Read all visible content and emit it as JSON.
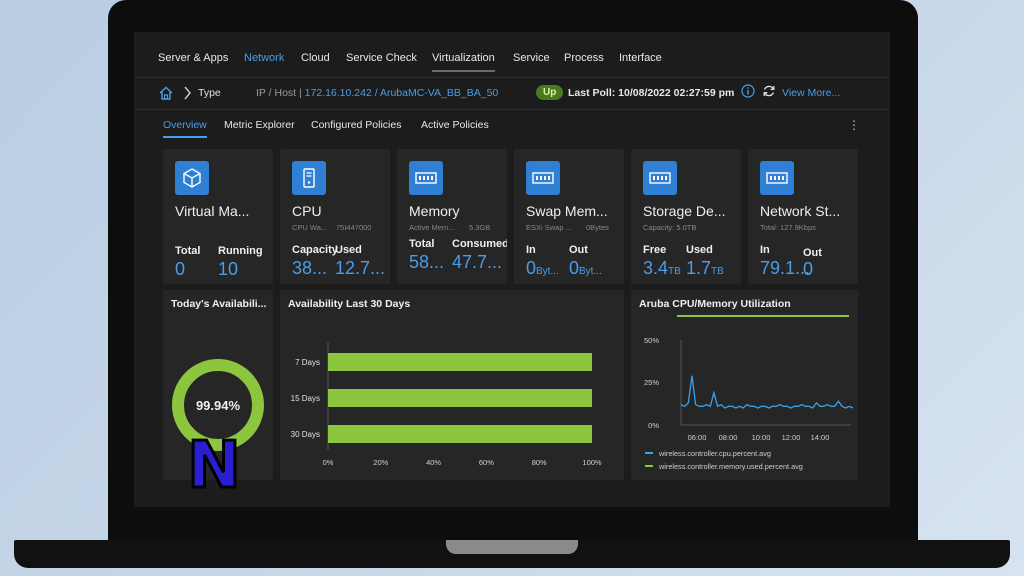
{
  "nav": {
    "tabs": [
      "Server & Apps",
      "Network",
      "Cloud",
      "Service Check",
      "Virtualization",
      "Service",
      "Process",
      "Interface"
    ],
    "active": "Network"
  },
  "breadcrumb": {
    "type_label": "Type",
    "path_prefix": "IP / Host | ",
    "path_link": "172.16.10.242 / ArubaMC-VA_BB_BA_50",
    "status": "Up",
    "last_poll": "Last Poll: 10/08/2022 02:27:59 pm",
    "view_more": "View More..."
  },
  "subtabs": [
    "Overview",
    "Metric Explorer",
    "Configured Policies",
    "Active Policies"
  ],
  "cards": {
    "virtual": {
      "title": "Virtual Ma...",
      "lbl1": "Total",
      "val1": "0",
      "lbl2": "Running",
      "val2": "10"
    },
    "cpu": {
      "title": "CPU",
      "sub": "CPU Wa...",
      "sub2": "75I447000",
      "lbl1": "Capacity",
      "val1": "38...",
      "lbl2": "Used",
      "val2": "12.7..."
    },
    "memory": {
      "title": "Memory",
      "sub": "Active Mem...",
      "sub2": "5.3GB",
      "lbl1": "Total",
      "val1": "58...",
      "lbl2": "Consumed",
      "val2": "47.7..."
    },
    "swap": {
      "title": "Swap Mem...",
      "sub": "ESXi Swap ...",
      "sub2": "0Bytes",
      "lbl1": "In",
      "val1": "0",
      "unit1": "Byt...",
      "lbl2": "Out",
      "val2": "0",
      "unit2": "Byt..."
    },
    "storage": {
      "title": "Storage De...",
      "sub": "Capacity: 5.0TB",
      "lbl1": "Free",
      "val1": "3.4",
      "unit1": "TB",
      "lbl2": "Used",
      "val2": "1.7",
      "unit2": "TB"
    },
    "network": {
      "title": "Network St...",
      "sub": "Total: 127.9Kbps",
      "lbl1": "In",
      "val1": "79.1...",
      "lbl2": "Out",
      "val2": "0"
    }
  },
  "availability_today": {
    "title": "Today's Availabili...",
    "value": "99.94%",
    "fraction": 0.9994
  },
  "availability_30": {
    "title": "Availability Last 30 Days",
    "chart_data": {
      "type": "bar",
      "orientation": "horizontal",
      "categories": [
        "7 Days",
        "15 Days",
        "30 Days"
      ],
      "values": [
        100,
        100,
        100
      ],
      "xlim": [
        0,
        100
      ],
      "xticks": [
        "0%",
        "20%",
        "40%",
        "60%",
        "80%",
        "100%"
      ],
      "color": "#8cc63f"
    }
  },
  "cpu_mem": {
    "title": "Aruba CPU/Memory Utilization",
    "chart_data": {
      "type": "line",
      "yticks": [
        "50%",
        "25%",
        "0%"
      ],
      "ylim": [
        0,
        50
      ],
      "xticks": [
        "06:00",
        "08:00",
        "10:00",
        "12:00",
        "14:00"
      ],
      "series": [
        {
          "name": "wireless.controller.cpu.percent.avg",
          "color": "#3aa0e8",
          "values": [
            12,
            11,
            13,
            29,
            12,
            11,
            11,
            12,
            11,
            19,
            11,
            12,
            10,
            11,
            11,
            10,
            11,
            10,
            12,
            11,
            11,
            10,
            11,
            11,
            10,
            11,
            11,
            12,
            11,
            11,
            10,
            11,
            11,
            12,
            11,
            11,
            10,
            13,
            11,
            11,
            12,
            11,
            11,
            14,
            11,
            10,
            11,
            10
          ]
        },
        {
          "name": "wireless.controller.memory.used.percent.avg",
          "color": "#8cc63f",
          "values": []
        }
      ]
    }
  }
}
